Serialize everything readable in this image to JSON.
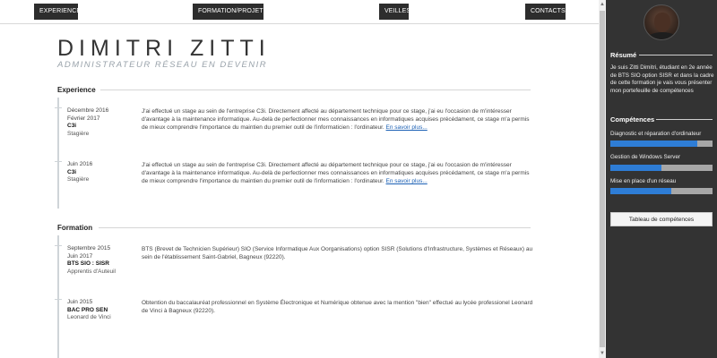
{
  "nav": {
    "items": [
      {
        "label": "EXPERIENCE"
      },
      {
        "label": "FORMATION/PROJETS"
      },
      {
        "label": "VEILLES"
      },
      {
        "label": "CONTACTS"
      }
    ]
  },
  "header": {
    "name": "DIMITRI ZITTI",
    "subtitle": "ADMINISTRATEUR RÉSEAU EN DEVENIR"
  },
  "experience": {
    "title": "Experience",
    "entries": [
      {
        "date_start": "Décembre 2016",
        "date_end": "Février 2017",
        "org": "C3i",
        "role": "Stagière",
        "text": "J'ai effectué un stage au sein de l'entreprise C3i. Directement affecté au département technique pour ce stage, j'ai eu l'occasion de m'intéresser d'avantage à la maintenance informatique. Au-delà de perfectionner mes connaissances en informatiques acquises précédament, ce stage m'a permis de mieux comprendre l'importance du maintien du premier outil de l'informaticien : l'ordinateur.",
        "link": "En savoir plus..."
      },
      {
        "date_start": "Juin 2016",
        "date_end": "",
        "org": "C3i",
        "role": "Stagière",
        "text": "J'ai effectué un stage au sein de l'entreprise C3i. Directement affecté au département technique pour ce stage, j'ai eu l'occasion de m'intéresser d'avantage à la maintenance informatique. Au-delà de perfectionner mes connaissances en informatiques acquises précédament, ce stage m'a permis de mieux comprendre l'importance du maintien du premier outil de l'informaticien : l'ordinateur.",
        "link": "En savoir plus..."
      }
    ]
  },
  "formation": {
    "title": "Formation",
    "entries": [
      {
        "date_start": "Septembre 2015",
        "date_end": "Juin 2017",
        "org": "BTS SIO : SISR",
        "role": "Apprentis d'Auteuil",
        "text": "BTS (Brevet de Technicien Supérieur) SIO (Service Informatique Aux Oorganisations) option SISR (Solutions d'Infrastructure, Systèmes et Réseaux) au sein de l'établissement Saint-Gabriel, Bagneux (92220)."
      },
      {
        "date_start": "Juin 2015",
        "date_end": "",
        "org": "BAC PRO SEN",
        "role": "Leonard de Vinci",
        "text": "Obtention du baccalauréat professionnel en Système Électronique et Numérique obtenue avec la mention \"bien\" effectué au lycée professionel Leonard de Vinci à Bagneux (92220)."
      }
    ]
  },
  "sidebar": {
    "resume_title": "Résumé",
    "resume_text": "Je suis Zitti Dimitri, étudiant en 2e année de BTS SIO option SISR et dans la cadre de cette formation je vais vous présenter mon portefeuille de compétences",
    "skills_title": "Compétences",
    "skills": [
      {
        "label": "Diagnostic et réparation d'ordinateur",
        "level": 0.85
      },
      {
        "label": "Gestion de Windows Server",
        "level": 0.5
      },
      {
        "label": "Mise en place d'un réseau",
        "level": 0.6
      }
    ],
    "button_label": "Tableau de compétences"
  },
  "colors": {
    "sidebar_bg": "#333333",
    "nav_bg": "#2d2d2d",
    "skill_fill": "#2e7dd6",
    "link": "#1a5fb4"
  }
}
